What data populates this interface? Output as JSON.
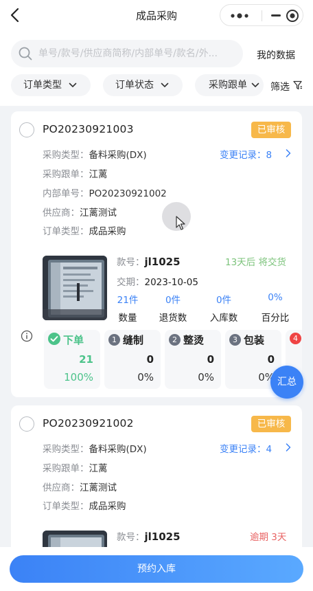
{
  "nav": {
    "title": "成品采购"
  },
  "search": {
    "placeholder": "单号/款号/供应商简称/内部单号/款名/外...",
    "my_data": "我的数据"
  },
  "filters": {
    "order_type": "订单类型",
    "order_status": "订单状态",
    "purchase_follow": "采购跟单",
    "filter": "筛选"
  },
  "orders": [
    {
      "po_no": "PO20230921003",
      "status": "已审核",
      "purchase_type_label": "采购类型：",
      "purchase_type": "备料采购(DX)",
      "change_log": "变更记录：8",
      "follower_label": "采购跟单：",
      "follower": "江蓠",
      "internal_label": "内部单号：",
      "internal_no": "PO20230921002",
      "supplier_label": "供应商：",
      "supplier": "江蓠测试",
      "order_type_label": "订单类型：",
      "order_type": "成品采购",
      "style_label": "款号：",
      "style_no": "jl1025",
      "delivery_hint": "13天后 将交货",
      "delivery_date_label": "交期：",
      "delivery_date": "2023-10-05",
      "stats": [
        {
          "value": "21件",
          "label": "数量"
        },
        {
          "value": "0件",
          "label": "退货数"
        },
        {
          "value": "0件",
          "label": "入库数"
        },
        {
          "value": "0%",
          "label": "百分比"
        }
      ],
      "processes": [
        {
          "name": "下单",
          "qty": "21",
          "pct": "100%"
        },
        {
          "num": "1",
          "name": "缝制",
          "qty": "0",
          "pct": "0%"
        },
        {
          "num": "2",
          "name": "整烫",
          "qty": "0",
          "pct": "0%"
        },
        {
          "num": "3",
          "name": "包装",
          "qty": "0",
          "pct": "0%"
        },
        {
          "num": "4",
          "name": "",
          "qty": "",
          "pct": ""
        }
      ]
    },
    {
      "po_no": "PO20230921002",
      "status": "已审核",
      "purchase_type_label": "采购类型：",
      "purchase_type": "备料采购(DX)",
      "change_log": "变更记录：4",
      "follower_label": "采购跟单：",
      "follower": "江蓠",
      "supplier_label": "供应商：",
      "supplier": "江蓠测试",
      "order_type_label": "订单类型：",
      "order_type": "成品采购",
      "style_label": "款号：",
      "style_no": "jl1025",
      "delivery_hint": "逾期 3天"
    }
  ],
  "summary": "汇总",
  "bottom": {
    "appoint": "预约入库"
  },
  "colors": {
    "accent": "#3b82f6",
    "status_badge": "#f7b84a",
    "done_green": "#4cc38a",
    "overdue_red": "#e86363",
    "delivery_green": "#7cc37b"
  }
}
